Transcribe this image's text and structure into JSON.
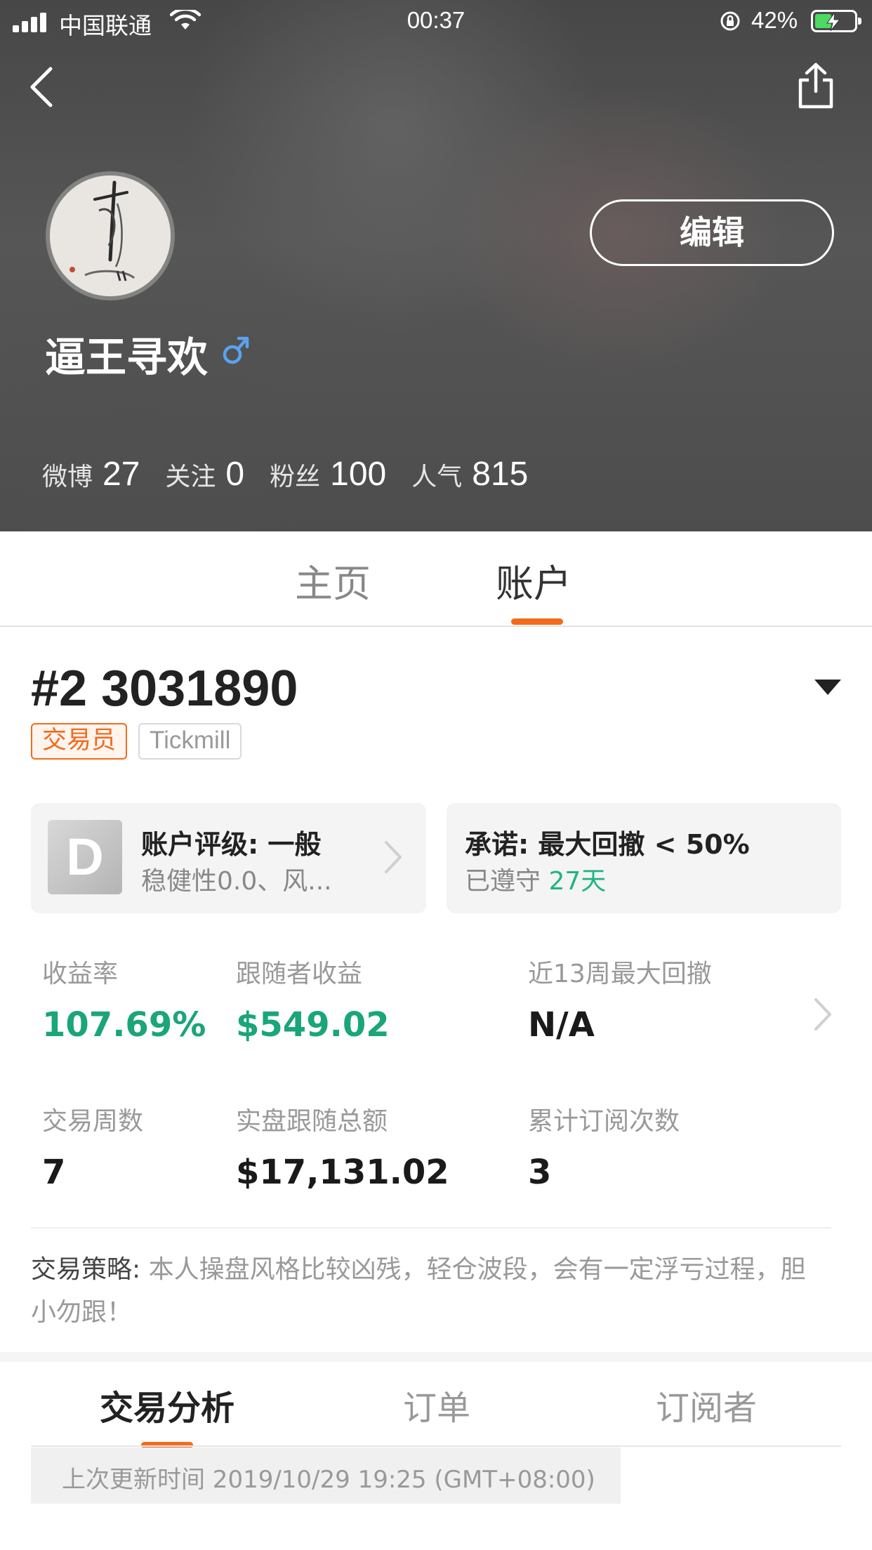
{
  "status_bar": {
    "carrier": "中国联通",
    "time": "00:37",
    "battery_percent": "42%",
    "battery_level": 0.42,
    "signal_icon": "signal-bars-icon",
    "wifi_icon": "wifi-icon",
    "orientation_lock_icon": "orientation-lock-icon",
    "battery_icon": "battery-charging-icon"
  },
  "header": {
    "back_icon": "back-chevron-icon",
    "share_icon": "share-icon",
    "edit_label": "编辑",
    "username": "逼王寻欢",
    "gender_icon": "male-icon",
    "stats": [
      {
        "label": "微博",
        "value": "27"
      },
      {
        "label": "关注",
        "value": "0"
      },
      {
        "label": "粉丝",
        "value": "100"
      },
      {
        "label": "人气",
        "value": "815"
      }
    ]
  },
  "profile_tabs": [
    {
      "label": "主页",
      "active": false
    },
    {
      "label": "账户",
      "active": true
    }
  ],
  "account": {
    "id": "#2 3031890",
    "tags": [
      "交易员",
      "Tickmill"
    ],
    "rating_card": {
      "grade": "D",
      "title": "账户评级: 一般",
      "subtitle": "稳健性0.0、风..."
    },
    "promise_card": {
      "title": "承诺: 最大回撤 < 50%",
      "subtitle_prefix": "已遵守 ",
      "days": "27天"
    },
    "metrics": [
      {
        "label": "收益率",
        "value": "107.69%",
        "style": "green"
      },
      {
        "label": "跟随者收益",
        "value": "$549.02",
        "style": "green"
      },
      {
        "label": "近13周最大回撤",
        "value": "N/A",
        "style": "dark"
      },
      {
        "label": "交易周数",
        "value": "7",
        "style": "dark"
      },
      {
        "label": "实盘跟随总额",
        "value": "$17,131.02",
        "style": "dark"
      },
      {
        "label": "累计订阅次数",
        "value": "3",
        "style": "dark"
      }
    ],
    "strategy_label": "交易策略:",
    "strategy_text": " 本人操盘风格比较凶残，轻仓波段，会有一定浮亏过程，胆小勿跟！"
  },
  "sub_tabs": [
    {
      "label": "交易分析",
      "active": true
    },
    {
      "label": "订单",
      "active": false
    },
    {
      "label": "订阅者",
      "active": false
    }
  ],
  "update_text": "上次更新时间 2019/10/29 19:25 (GMT+08:00)",
  "colors": {
    "accent": "#f26b1d",
    "positive": "#1aa57b",
    "teal": "#1fb487",
    "header_bg": "#4d4d4d"
  }
}
